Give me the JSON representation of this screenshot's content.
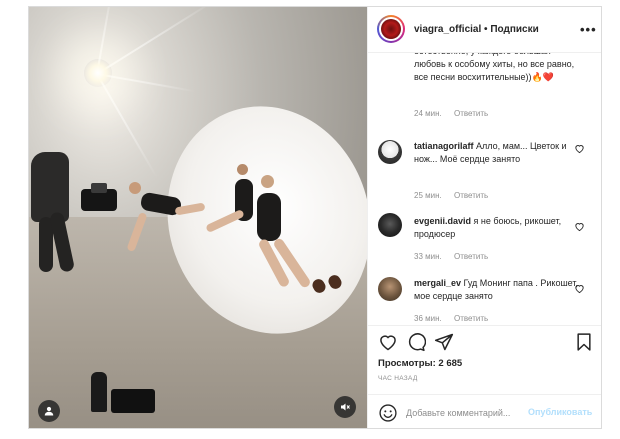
{
  "post": {
    "username": "viagra_official",
    "separator": "•",
    "follow_label": "Подписки",
    "more_label": "•••"
  },
  "comments": [
    {
      "user": "",
      "text": "естественно, у каждого большая любовь к особому хиты, но все равно, все песни восхитительные))🔥❤️",
      "time": "24 мин.",
      "reply": "Ответить"
    },
    {
      "user": "tatianagorilaff",
      "text": "Алло, мам... Цветок и нож... Моё сердце занято",
      "time": "25 мин.",
      "reply": "Ответить"
    },
    {
      "user": "evgenii.david",
      "text": "я не боюсь, рикошет, продюсер",
      "time": "33 мин.",
      "reply": "Ответить"
    },
    {
      "user": "mergali_ev",
      "text": "Гуд Монинг папа . Рикошет, мое сердце занято",
      "time": "36 мин.",
      "reply": "Ответить"
    }
  ],
  "stats": {
    "views": "Просмотры: 2 685",
    "time": "час назад"
  },
  "add_comment": {
    "placeholder": "Добавьте комментарий...",
    "publish_label": "Опубликовать"
  },
  "icons": {
    "like": "heart-icon",
    "comment": "comment-icon",
    "share": "send-icon",
    "save": "bookmark-icon",
    "emoji": "emoji-icon",
    "user_tag": "user-tag-icon",
    "mute": "mute-icon"
  },
  "colors": {
    "link_disabled": "#b2dffc",
    "muted_text": "#8e8e8e",
    "border": "#dbdbdb"
  }
}
